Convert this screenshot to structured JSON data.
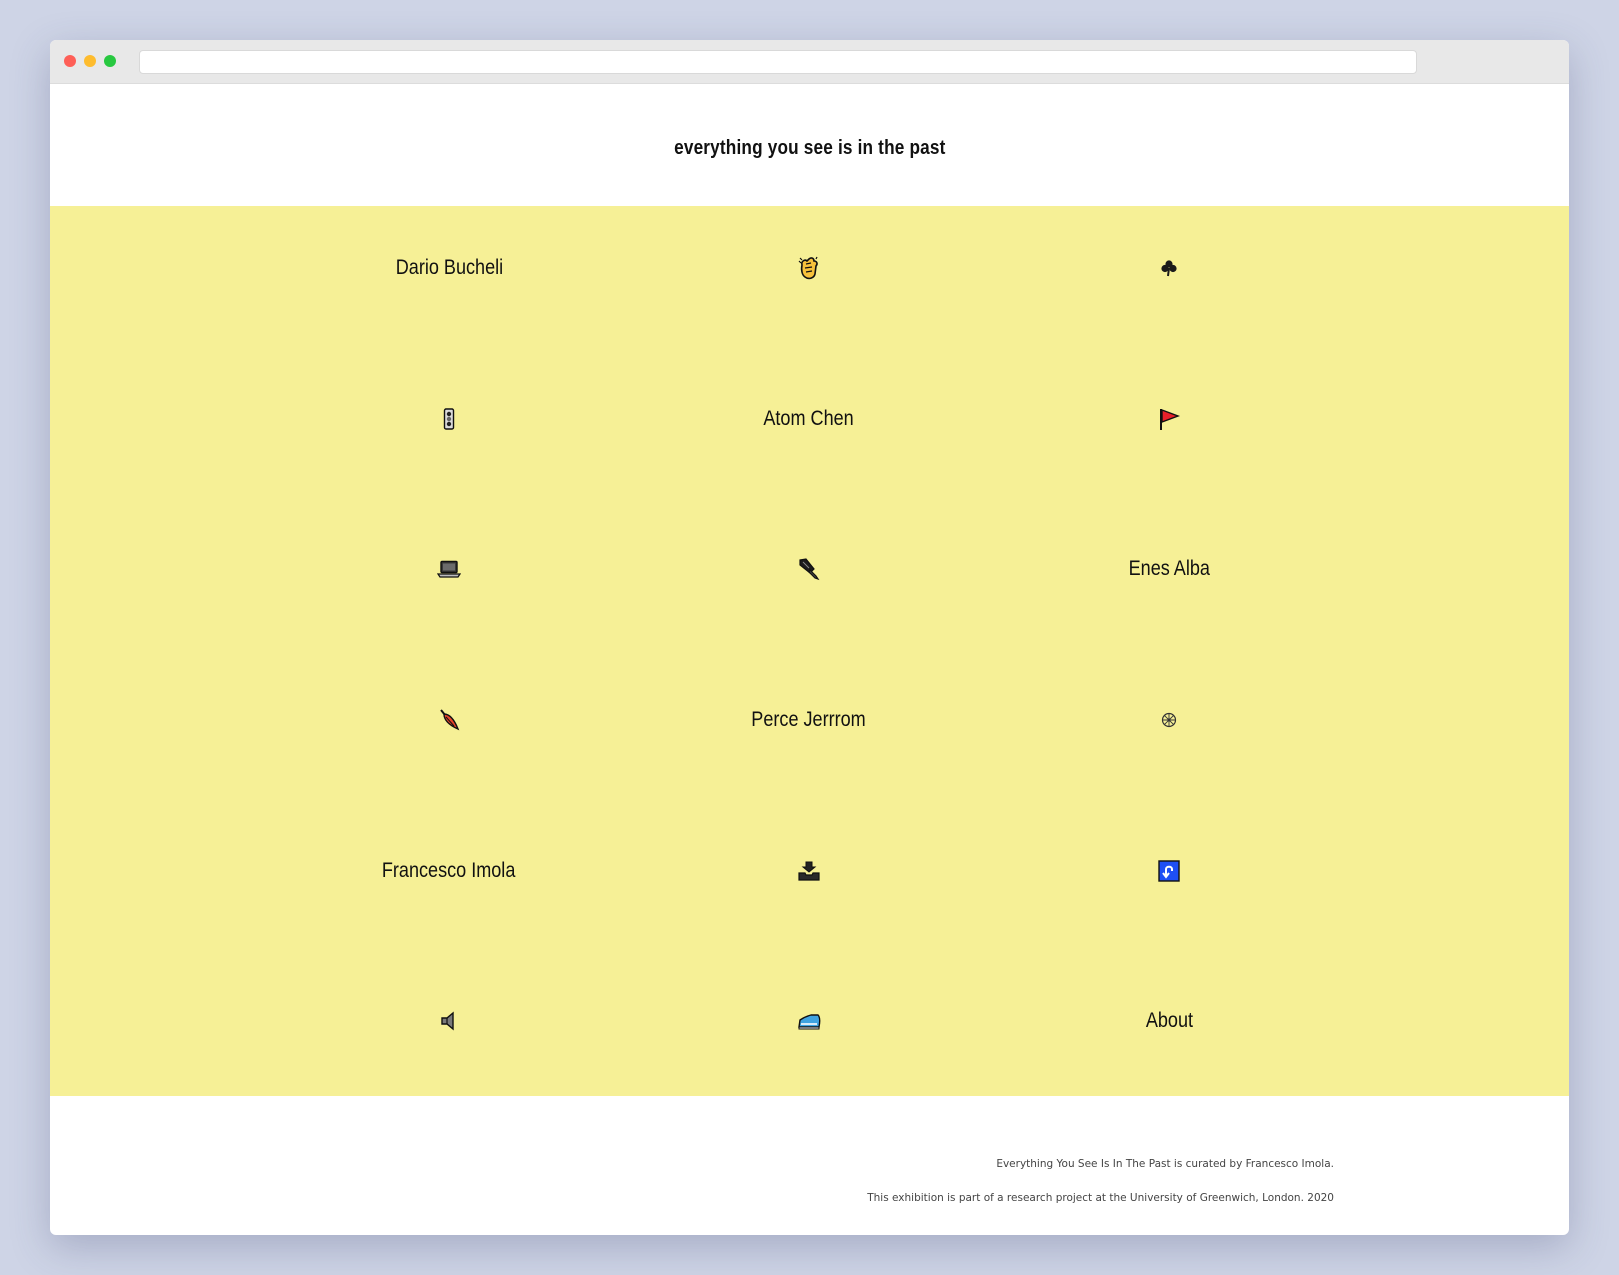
{
  "site": {
    "title": "everything you see is in the past"
  },
  "grid": {
    "background": "#f6f096",
    "cells": [
      {
        "type": "link",
        "label": "Dario Bucheli"
      },
      {
        "type": "icon",
        "icon": "clapping-hands-icon"
      },
      {
        "type": "icon",
        "icon": "shamrock-icon"
      },
      {
        "type": "icon",
        "icon": "traffic-light-icon"
      },
      {
        "type": "link",
        "label": "Atom Chen"
      },
      {
        "type": "icon",
        "icon": "red-flag-icon"
      },
      {
        "type": "icon",
        "icon": "laptop-icon"
      },
      {
        "type": "icon",
        "icon": "fountain-pen-icon"
      },
      {
        "type": "link",
        "label": "Enes Alba"
      },
      {
        "type": "icon",
        "icon": "closed-umbrella-icon"
      },
      {
        "type": "link",
        "label": "Perce Jerrrom"
      },
      {
        "type": "icon",
        "icon": "wheel-icon"
      },
      {
        "type": "link",
        "label": "Francesco Imola"
      },
      {
        "type": "icon",
        "icon": "inbox-tray-icon"
      },
      {
        "type": "icon",
        "icon": "right-arrow-curving-left-icon"
      },
      {
        "type": "icon",
        "icon": "speaker-icon"
      },
      {
        "type": "icon",
        "icon": "running-shoe-icon"
      },
      {
        "type": "link",
        "label": "About"
      }
    ]
  },
  "footer": {
    "line1": "Everything You See Is In The Past is curated by Francesco Imola.",
    "line2": "This exhibition is part of a research project at the University of Greenwich, London. 2020"
  }
}
